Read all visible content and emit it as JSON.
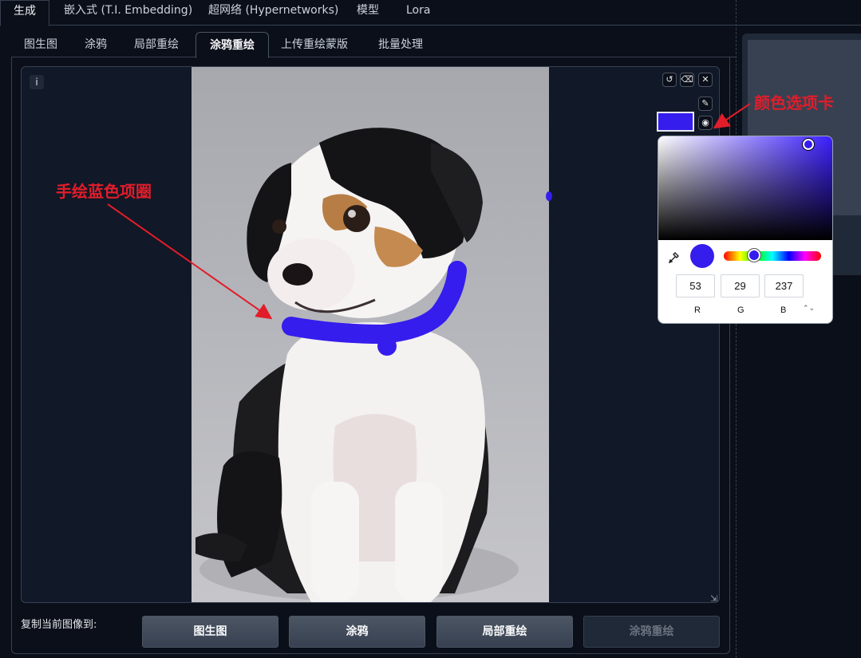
{
  "top_tabs": [
    "生成",
    "嵌入式 (T.I. Embedding)",
    "超网络 (Hypernetworks)",
    "模型",
    "Lora"
  ],
  "sub_tabs": [
    "图生图",
    "涂鸦",
    "局部重绘",
    "涂鸦重绘",
    "上传重绘蒙版",
    "批量处理"
  ],
  "canvas": {
    "info_label": "i",
    "undo_icon": "undo-icon",
    "clear_icon": "eraser-icon",
    "close_icon": "close-icon",
    "brush_icon": "brush-icon",
    "palette_icon": "palette-icon",
    "brush_color": "#351ded"
  },
  "color_picker": {
    "r": "53",
    "g": "29",
    "b": "237",
    "r_label": "R",
    "g_label": "G",
    "b_label": "B",
    "mode_toggle": "⌃⌄"
  },
  "annotations": {
    "collar": "手绘蓝色项圈",
    "color_tab": "颜色选项卡"
  },
  "copy": {
    "label": "复制当前图像到:",
    "buttons": [
      "图生图",
      "涂鸦",
      "局部重绘",
      "涂鸦重绘"
    ]
  },
  "colors": {
    "annotation": "#e11d2a",
    "brush": "#351ded",
    "background": "#0b0f19"
  }
}
